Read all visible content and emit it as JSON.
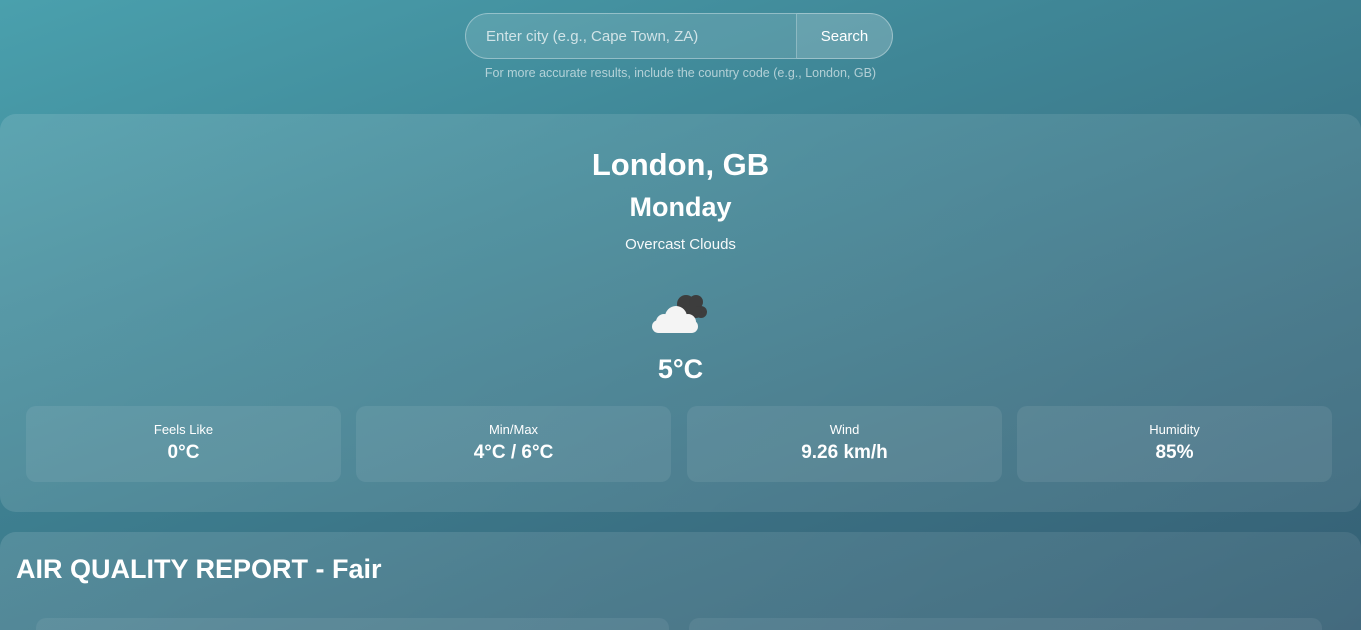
{
  "search": {
    "placeholder": "Enter city (e.g., Cape Town, ZA)",
    "value": "",
    "button_label": "Search",
    "hint": "For more accurate results, include the country code (e.g., London, GB)"
  },
  "weather": {
    "city": "London, GB",
    "day": "Monday",
    "description": "Overcast Clouds",
    "icon": "overcast-clouds-icon",
    "temperature": "5°C",
    "stats": [
      {
        "label": "Feels Like",
        "value": "0°C"
      },
      {
        "label": "Min/Max",
        "value": "4°C / 6°C"
      },
      {
        "label": "Wind",
        "value": "9.26 km/h"
      },
      {
        "label": "Humidity",
        "value": "85%"
      }
    ]
  },
  "air_quality": {
    "title": "AIR QUALITY REPORT - Fair"
  },
  "colors": {
    "background_start": "#4aa0ad",
    "background_end": "#355f74",
    "text": "#ffffff",
    "cloud_dark": "#3d3d3d",
    "cloud_light": "#f4f4f4"
  }
}
